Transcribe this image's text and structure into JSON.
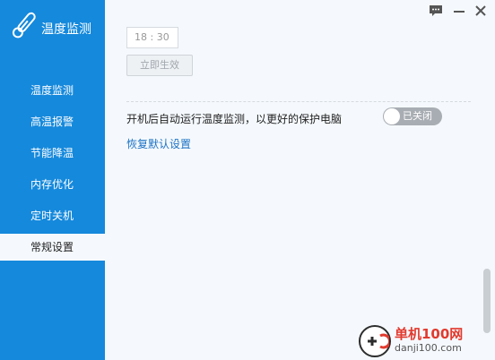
{
  "app": {
    "title": "温度监测"
  },
  "sidebar": {
    "items": [
      {
        "label": "温度监测",
        "active": false
      },
      {
        "label": "高温报警",
        "active": false
      },
      {
        "label": "节能降温",
        "active": false
      },
      {
        "label": "内存优化",
        "active": false
      },
      {
        "label": "定时关机",
        "active": false
      },
      {
        "label": "常规设置",
        "active": true
      }
    ]
  },
  "main": {
    "time_value": "18 : 30",
    "apply_label": "立即生效",
    "startup_label": "开机后自动运行温度监测，以更好的保护电脑",
    "toggle_label": "已关闭",
    "toggle_on": false,
    "reset_label": "恢复默认设置"
  },
  "watermark": {
    "brand": "单机100网",
    "url": "danji100.com"
  },
  "colors": {
    "sidebar_bg": "#1589dc",
    "content_bg": "#f5f9fd",
    "link": "#1d72c4",
    "toggle_off": "#a8adb3"
  },
  "icons": {
    "logo": "thermometer-icon",
    "feedback": "chat-icon",
    "minimize": "minimize-icon",
    "close": "close-icon"
  }
}
